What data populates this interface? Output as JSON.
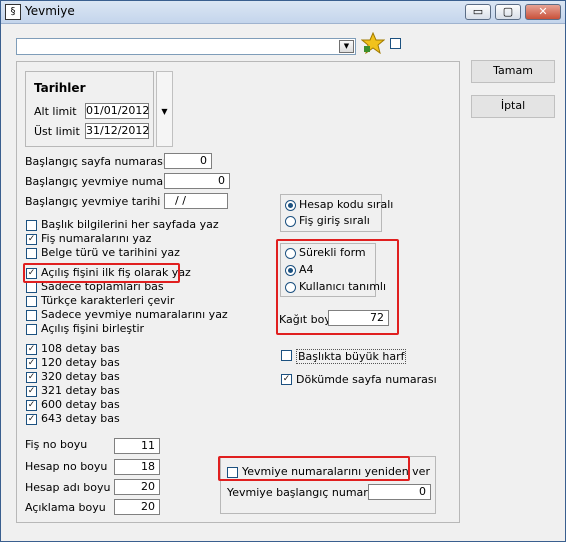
{
  "window": {
    "title": "Yevmiye",
    "min_glyph": "▭",
    "max_glyph": "▢",
    "close_glyph": "✕"
  },
  "top": {
    "combo_value": ""
  },
  "tarihler": {
    "title": "Tarihler",
    "alt_label": "Alt limit",
    "alt_value": "01/01/2012",
    "ust_label": "Üst limit",
    "ust_value": "31/12/2012"
  },
  "page": {
    "sayfa_label": "Başlangıç sayfa numarası",
    "sayfa_value": "0",
    "yevmiye_no_label": "Başlangıç yevmiye numarası",
    "yevmiye_no_value": "0",
    "yevmiye_tarih_label": "Başlangıç yevmiye tarihi",
    "yevmiye_tarih_value": " / /"
  },
  "options": [
    {
      "label": "Başlık bilgilerini her sayfada yaz",
      "checked": false
    },
    {
      "label": "Fiş numaralarını yaz",
      "checked": true
    },
    {
      "label": "Belge türü ve tarihini yaz",
      "checked": false
    },
    {
      "label": "Açılış fişini ilk fiş olarak yaz",
      "checked": true
    },
    {
      "label": "Sadece toplamları bas",
      "checked": false
    },
    {
      "label": "Türkçe karakterleri çevir",
      "checked": false
    },
    {
      "label": "Sadece yevmiye numaralarını yaz",
      "checked": false
    },
    {
      "label": "Açılış fişini birleştir",
      "checked": false
    }
  ],
  "detay": [
    {
      "label": "108 detay bas",
      "checked": true
    },
    {
      "label": "120 detay bas",
      "checked": true
    },
    {
      "label": "320 detay bas",
      "checked": true
    },
    {
      "label": "321 detay bas",
      "checked": true
    },
    {
      "label": "600 detay bas",
      "checked": true
    },
    {
      "label": "643 detay bas",
      "checked": true
    }
  ],
  "sizes": [
    {
      "label": "Fiş no boyu",
      "value": "11"
    },
    {
      "label": "Hesap no boyu",
      "value": "18"
    },
    {
      "label": "Hesap adı boyu",
      "value": "20"
    },
    {
      "label": "Açıklama boyu",
      "value": "20"
    }
  ],
  "sort": {
    "kod": "Hesap kodu sıralı",
    "giris": "Fiş giriş sıralı"
  },
  "paper": {
    "surekli": "Sürekli form",
    "a4": "A4",
    "kullanici": "Kullanıcı tanımlı",
    "boy_label": "Kağıt boyu",
    "boy_value": "72"
  },
  "extra": {
    "baslik_buyuk": "Başlıkta büyük harf",
    "dokum_sayfa": "Dökümde sayfa numarası"
  },
  "renumber": {
    "label": "Yevmiye numaralarını yeniden ver",
    "start_label": "Yevmiye başlangıç numarası",
    "start_value": "0"
  },
  "buttons": {
    "ok": "Tamam",
    "cancel": "İptal"
  },
  "check_glyph": "✓",
  "colors": {
    "highlight_red": "#e01f1f",
    "star": "#f2c21c"
  }
}
